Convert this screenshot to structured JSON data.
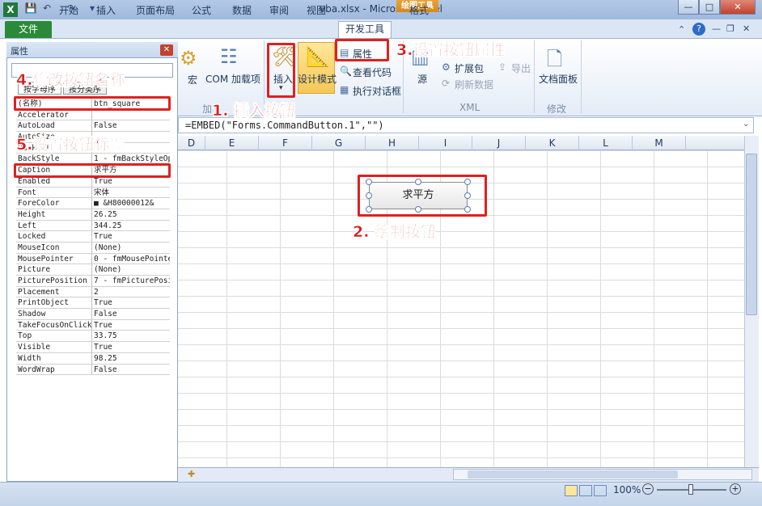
{
  "window": {
    "title": "vba.xlsx - Microsoft Excel",
    "context_tab": "绘图工具",
    "min": "—",
    "max": "□",
    "close": "✕"
  },
  "tabs": [
    "文件",
    "开始",
    "插入",
    "页面布局",
    "公式",
    "数据",
    "审阅",
    "视图",
    "开发工具",
    "格式"
  ],
  "ribbon": {
    "code_group_partial": "宏",
    "com_addins": "COM 加载项",
    "insert": "插入",
    "design_mode": "设计模式",
    "properties": "属性",
    "view_code": "查看代码",
    "run_dialog": "执行对话框",
    "source": "源",
    "expansion_pack": "扩展包",
    "refresh_data": "刷新数据",
    "export": "导出",
    "xml_label": "XML",
    "doc_panel": "文档面板",
    "modify_label": "修改",
    "controls_label_partial": "加"
  },
  "formula": "=EMBED(\"Forms.CommandButton.1\",\"\")",
  "columns": [
    "D",
    "E",
    "F",
    "G",
    "H",
    "I",
    "J",
    "K",
    "L",
    "M"
  ],
  "properties_panel": {
    "title": "属性",
    "tab_alpha": "按字母序",
    "tab_cat": "按分类序",
    "rows": [
      {
        "name": "(名称)",
        "value": "btn_square"
      },
      {
        "name": "Accelerator",
        "value": ""
      },
      {
        "name": "AutoLoad",
        "value": "False"
      },
      {
        "name": "AutoSize",
        "value": ""
      },
      {
        "name": "BackColor",
        "value": ""
      },
      {
        "name": "BackStyle",
        "value": "1 - fmBackStyleOp"
      },
      {
        "name": "Caption",
        "value": "求平方"
      },
      {
        "name": "Enabled",
        "value": "True"
      },
      {
        "name": "Font",
        "value": "宋体"
      },
      {
        "name": "ForeColor",
        "value": "■ &H80000012&"
      },
      {
        "name": "Height",
        "value": "26.25"
      },
      {
        "name": "Left",
        "value": "344.25"
      },
      {
        "name": "Locked",
        "value": "True"
      },
      {
        "name": "MouseIcon",
        "value": "(None)"
      },
      {
        "name": "MousePointer",
        "value": "0 - fmMousePointe"
      },
      {
        "name": "Picture",
        "value": "(None)"
      },
      {
        "name": "PicturePosition",
        "value": "7 - fmPicturePosi"
      },
      {
        "name": "Placement",
        "value": "2"
      },
      {
        "name": "PrintObject",
        "value": "True"
      },
      {
        "name": "Shadow",
        "value": "False"
      },
      {
        "name": "TakeFocusOnClick",
        "value": "True"
      },
      {
        "name": "Top",
        "value": "33.75"
      },
      {
        "name": "Visible",
        "value": "True"
      },
      {
        "name": "Width",
        "value": "98.25"
      },
      {
        "name": "WordWrap",
        "value": "False"
      }
    ]
  },
  "button_caption": "求平方",
  "annotations": {
    "a1": "1. 插入按钮",
    "a2": "2. 绘制按钮",
    "a3": "3.设置按钮属性",
    "a4": "4.修改按钮名称",
    "a5": "5.设置按钮标题"
  },
  "status": {
    "zoom": "100%"
  },
  "colors": {
    "accent_red": "#d81b1b",
    "file_tab": "#2a8a3a",
    "ribbon_blue": "#dbe6f4"
  }
}
